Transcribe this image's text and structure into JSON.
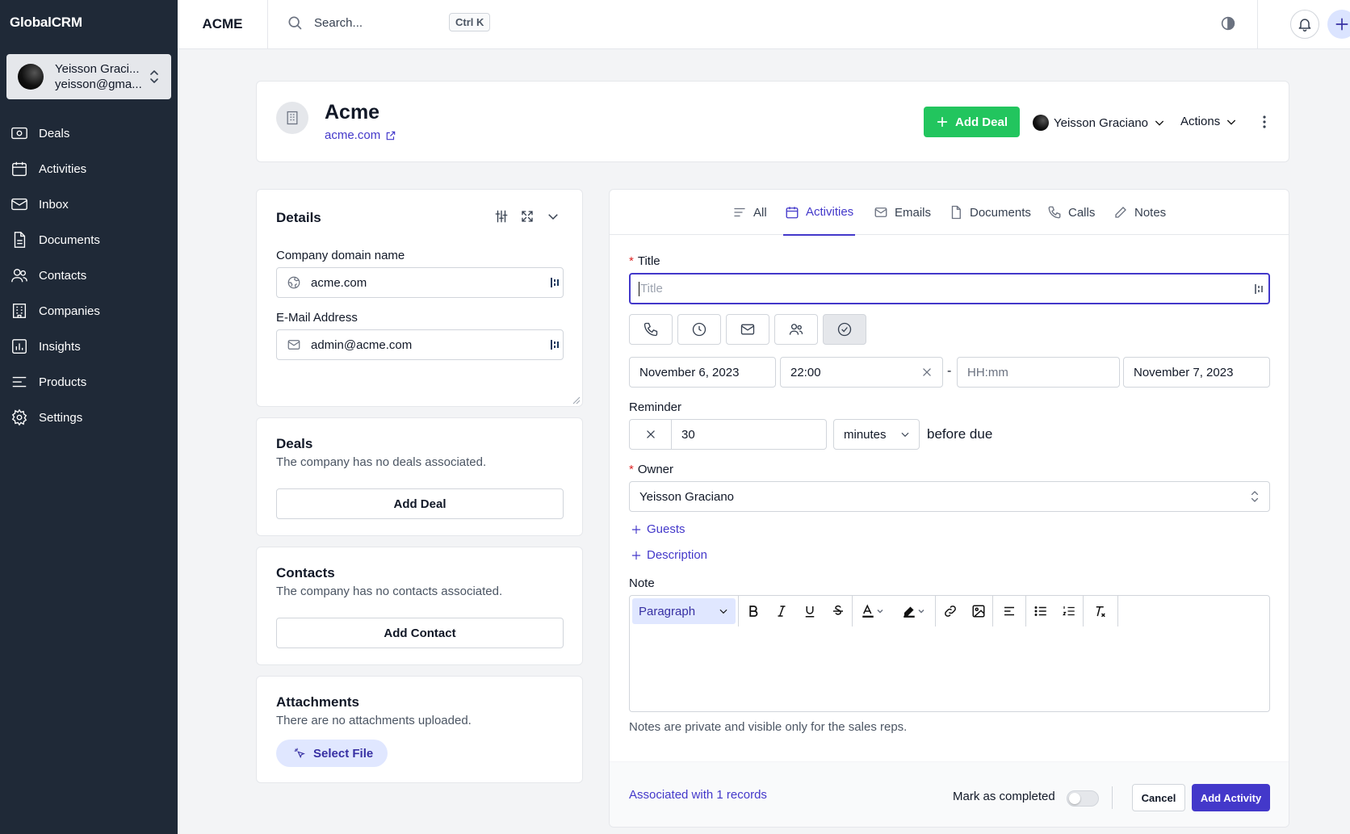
{
  "app": {
    "name": "GlobalCRM"
  },
  "user": {
    "name": "Yeisson Graci...",
    "email": "yeisson@gma..."
  },
  "nav": [
    {
      "label": "Deals",
      "icon": "deals-icon"
    },
    {
      "label": "Activities",
      "icon": "calendar-icon"
    },
    {
      "label": "Inbox",
      "icon": "mail-icon"
    },
    {
      "label": "Documents",
      "icon": "document-icon"
    },
    {
      "label": "Contacts",
      "icon": "users-icon"
    },
    {
      "label": "Companies",
      "icon": "building-icon"
    },
    {
      "label": "Insights",
      "icon": "chart-icon"
    },
    {
      "label": "Products",
      "icon": "list-icon"
    },
    {
      "label": "Settings",
      "icon": "gear-icon"
    }
  ],
  "topbar": {
    "workspace": "ACME",
    "search_placeholder": "Search...",
    "shortcut": "Ctrl K"
  },
  "company": {
    "name": "Acme",
    "domain": "acme.com",
    "add_deal_label": "Add Deal",
    "owner": "Yeisson Graciano",
    "actions_label": "Actions"
  },
  "details": {
    "title": "Details",
    "domain_label": "Company domain name",
    "domain_value": "acme.com",
    "email_label": "E-Mail Address",
    "email_value": "admin@acme.com"
  },
  "deals": {
    "title": "Deals",
    "empty": "The company has no deals associated.",
    "button": "Add Deal"
  },
  "contacts": {
    "title": "Contacts",
    "empty": "The company has no contacts associated.",
    "button": "Add Contact"
  },
  "attachments": {
    "title": "Attachments",
    "empty": "There are no attachments uploaded.",
    "button": "Select File"
  },
  "tabs": [
    {
      "label": "All",
      "icon": "lines-icon",
      "active": false
    },
    {
      "label": "Activities",
      "icon": "calendar-icon",
      "active": true
    },
    {
      "label": "Emails",
      "icon": "mail-icon",
      "active": false
    },
    {
      "label": "Documents",
      "icon": "document-icon",
      "active": false
    },
    {
      "label": "Calls",
      "icon": "phone-icon",
      "active": false
    },
    {
      "label": "Notes",
      "icon": "pencil-icon",
      "active": false
    }
  ],
  "activity_form": {
    "title_label": "Title",
    "title_placeholder": "Title",
    "start_date": "November 6, 2023",
    "start_time": "22:00",
    "end_time_placeholder": "HH:mm",
    "end_date": "November 7, 2023",
    "dash": "-",
    "reminder_label": "Reminder",
    "reminder_value": "30",
    "reminder_unit": "minutes",
    "reminder_suffix": "before due",
    "owner_label": "Owner",
    "owner_value": "Yeisson Graciano",
    "guests_label": "Guests",
    "description_label": "Description",
    "note_label": "Note",
    "paragraph_label": "Paragraph",
    "note_help": "Notes are private and visible only for the sales reps.",
    "associated": "Associated with 1 records",
    "mark_completed": "Mark as completed",
    "completed": false,
    "cancel": "Cancel",
    "submit": "Add Activity"
  },
  "colors": {
    "sidebar": "#1f2937",
    "accent": "#4338ca",
    "green": "#22c55e",
    "required": "#dc2626"
  }
}
